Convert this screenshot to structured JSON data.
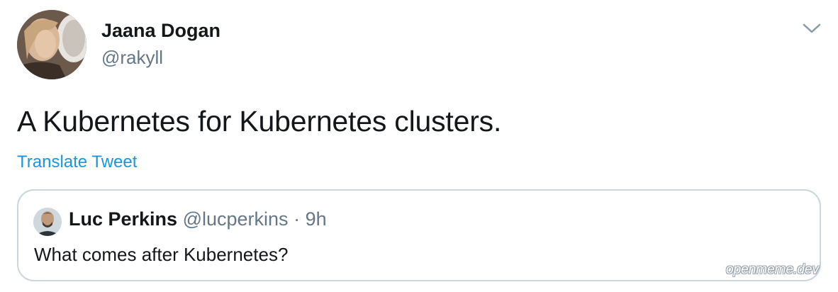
{
  "tweet": {
    "author": {
      "name": "Jaana Dogan",
      "handle": "@rakyll"
    },
    "text": "A Kubernetes for Kubernetes clusters.",
    "translate_label": "Translate Tweet",
    "menu_icon": "chevron-down-icon"
  },
  "quoted_tweet": {
    "author_name": "Luc Perkins",
    "author_handle": "@lucperkins",
    "separator": "·",
    "time": "9h",
    "text": "What comes after Kubernetes?"
  },
  "watermark": "openmeme.dev",
  "colors": {
    "text_primary": "#14171a",
    "text_secondary": "#657786",
    "link": "#1b95e0",
    "border": "#ccd6dd"
  }
}
